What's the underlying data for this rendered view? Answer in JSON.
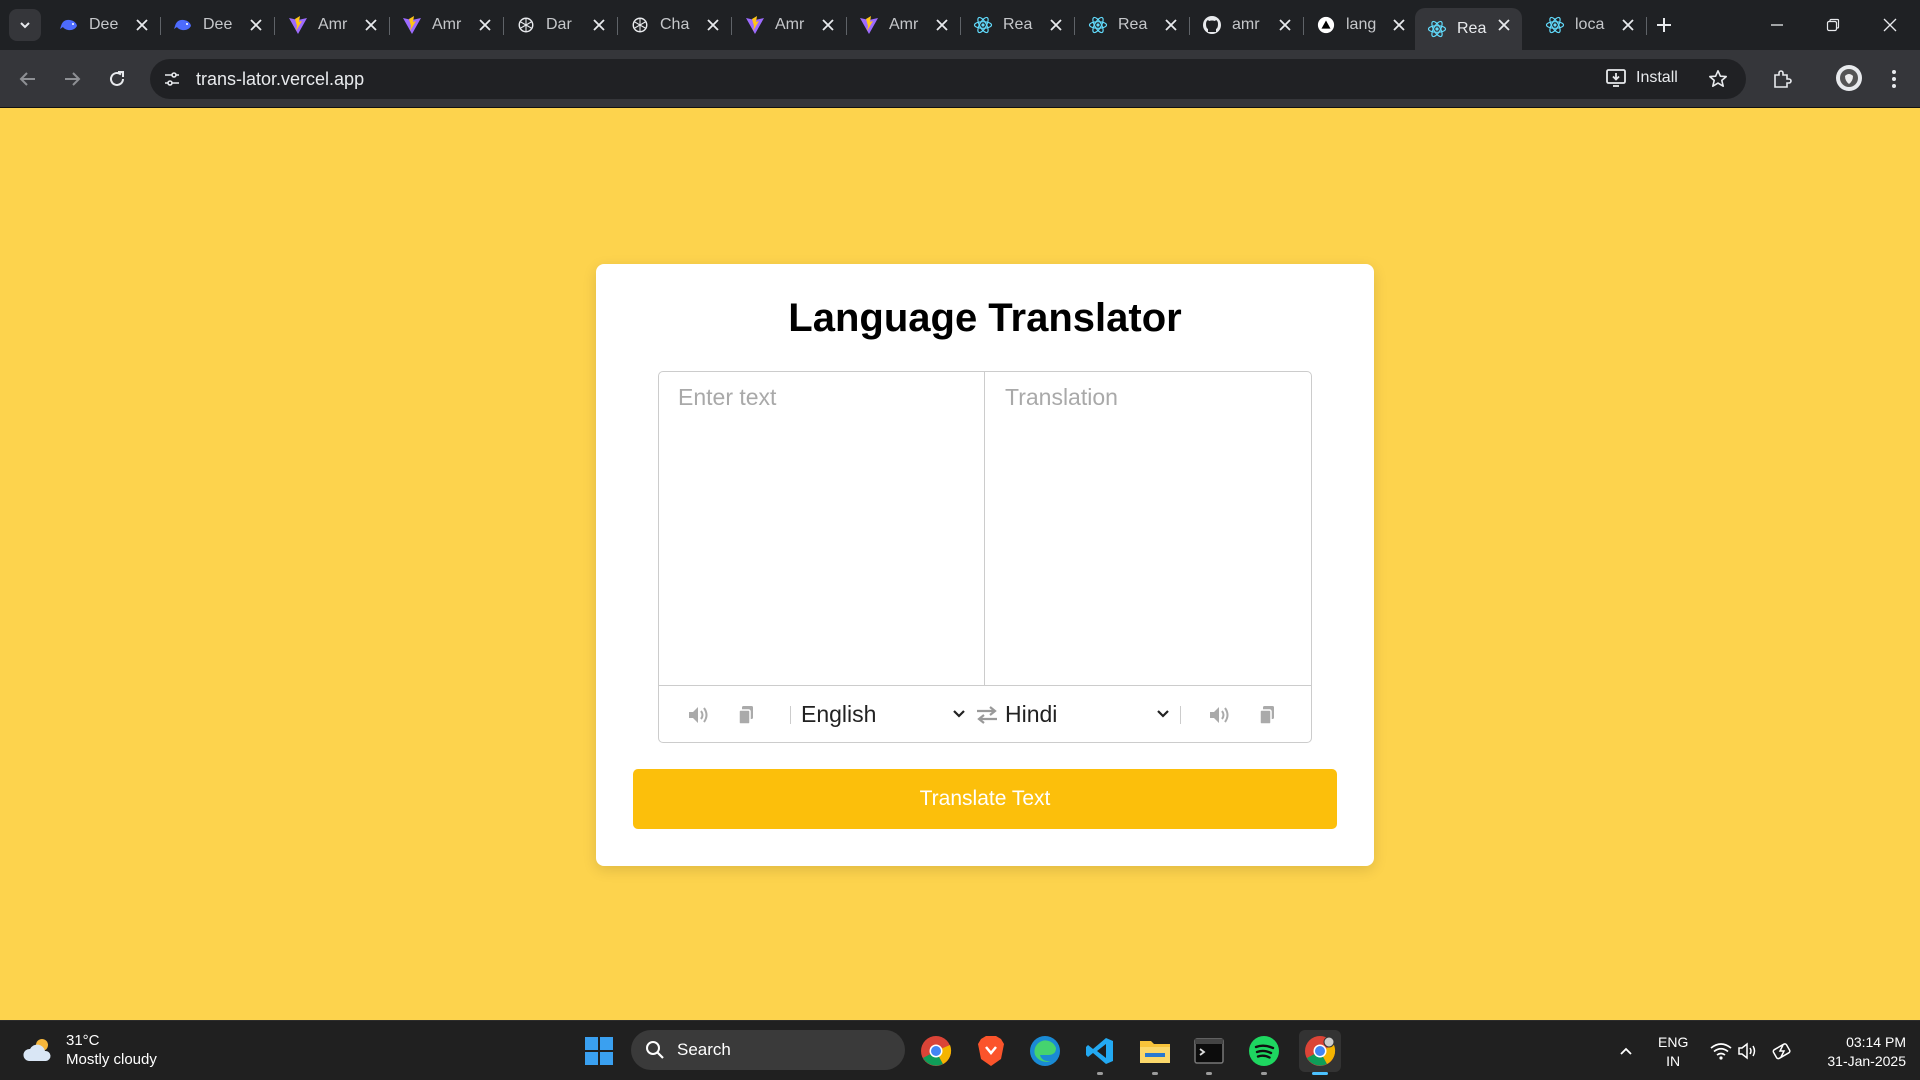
{
  "browser": {
    "tabs": [
      {
        "title": "Dee",
        "favicon": "deepseek-whale-icon"
      },
      {
        "title": "Dee",
        "favicon": "deepseek-whale-icon"
      },
      {
        "title": "Amr",
        "favicon": "vite-icon"
      },
      {
        "title": "Amr",
        "favicon": "vite-icon"
      },
      {
        "title": "Dar",
        "favicon": "chatgpt-icon"
      },
      {
        "title": "Cha",
        "favicon": "chatgpt-icon"
      },
      {
        "title": "Amr",
        "favicon": "vite-icon"
      },
      {
        "title": "Amr",
        "favicon": "vite-icon"
      },
      {
        "title": "Rea",
        "favicon": "react-icon"
      },
      {
        "title": "Rea",
        "favicon": "react-icon"
      },
      {
        "title": "amr",
        "favicon": "github-icon"
      },
      {
        "title": "lang",
        "favicon": "vercel-icon"
      },
      {
        "title": "Rea",
        "favicon": "react-icon",
        "active": true
      },
      {
        "title": "loca",
        "favicon": "react-icon"
      }
    ],
    "url": "trans-lator.vercel.app",
    "install_label": "Install"
  },
  "app": {
    "title": "Language Translator",
    "from_placeholder": "Enter text",
    "to_placeholder": "Translation",
    "from_language": "English",
    "to_language": "Hindi",
    "translate_button": "Translate Text",
    "colors": {
      "page_background": "#fdd34d",
      "button": "#fcbf0b",
      "card": "#ffffff"
    }
  },
  "taskbar": {
    "weather": {
      "temp": "31°C",
      "desc": "Mostly cloudy"
    },
    "search_label": "Search",
    "apps": [
      "chrome-icon",
      "brave-icon",
      "edge-icon",
      "vscode-icon",
      "file-explorer-icon",
      "terminal-icon",
      "spotify-icon",
      "chrome-active-icon"
    ],
    "lang_line1": "ENG",
    "lang_line2": "IN",
    "time": "03:14 PM",
    "date": "31-Jan-2025"
  }
}
